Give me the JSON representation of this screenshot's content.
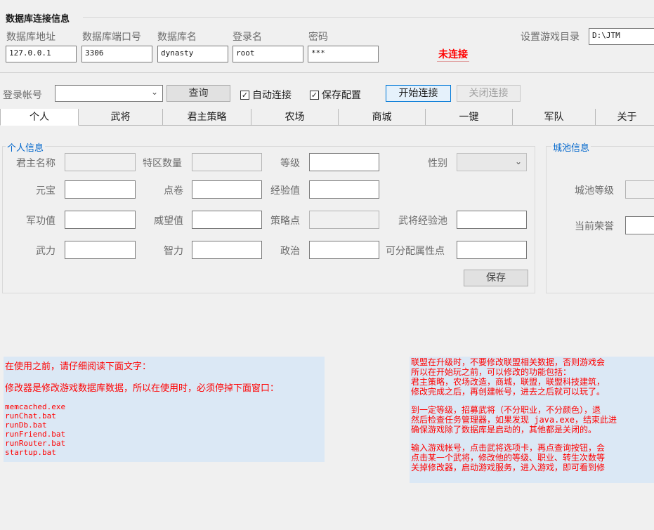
{
  "db": {
    "section_title": "数据库连接信息",
    "address_label": "数据库地址",
    "port_label": "数据库端口号",
    "dbname_label": "数据库名",
    "user_label": "登录名",
    "password_label": "密码",
    "address": "127.0.0.1",
    "port": "3306",
    "dbname": "dynasty",
    "user": "root",
    "password": "***",
    "status": "未连接",
    "status_color": "#ff0000",
    "game_dir_label": "设置游戏目录",
    "game_dir": "D:\\JTM"
  },
  "login": {
    "account_label": "登录帐号",
    "account_value": "",
    "query_button": "查询",
    "auto_connect": {
      "label": "自动连接",
      "checked": true
    },
    "save_config": {
      "label": "保存配置",
      "checked": true
    },
    "start_button": "开始连接",
    "close_button": "关闭连接"
  },
  "tabs": [
    "个人",
    "武将",
    "君主策略",
    "农场",
    "商城",
    "一键",
    "军队",
    "关于"
  ],
  "personal": {
    "title": "个人信息",
    "labels": {
      "monarch_name": "君主名称",
      "zone_count": "特区数量",
      "level": "等级",
      "gender": "性别",
      "yuanbao": "元宝",
      "points": "点卷",
      "exp": "经验值",
      "merit": "军功值",
      "prestige": "威望值",
      "strategy_points": "策略点",
      "general_exp_pool": "武将经验池",
      "force": "武力",
      "intelligence": "智力",
      "politics": "政治",
      "allocatable_points": "可分配属性点"
    },
    "save_button": "保存"
  },
  "city": {
    "title": "城池信息",
    "level_label": "城池等级",
    "honor_label": "当前荣誉"
  },
  "notes_left": {
    "lines": [
      "在使用之前，请仔细阅读下面文字：",
      "修改器是修改游戏数据库数据，所以在使用时，必须停掉下面窗口：",
      "memcached.exe",
      "runChat.bat",
      "runDb.bat",
      "runFriend.bat",
      "runRouter.bat",
      "startup.bat"
    ]
  },
  "notes_right": {
    "lines": [
      "联盟在升级时，不要修改联盟相关数据，否则游戏会",
      "所以在开始玩之前，可以修改的功能包括：",
      "君主策略，农场改造，商城，联盟，联盟科技建筑，",
      "修改完成之后，再创建帐号，进去之后就可以玩了。",
      "到一定等级，招募武将（不分职业，不分颜色），退",
      "然后检查任务管理器，如果发现 java.exe，结束此进",
      "确保游戏除了数据库是启动的，其他都是关闭的。",
      "输入游戏帐号，点击武将选项卡，再点查询按钮，会",
      "点击某一个武将，修改他的等级、职业、转生次数等",
      "关掉修改器，启动游戏服务，进入游戏，即可看到修"
    ]
  },
  "colors": {
    "note_bg": "#dbe8f5",
    "note_text": "#ff0000",
    "accent": "#0078d7"
  }
}
